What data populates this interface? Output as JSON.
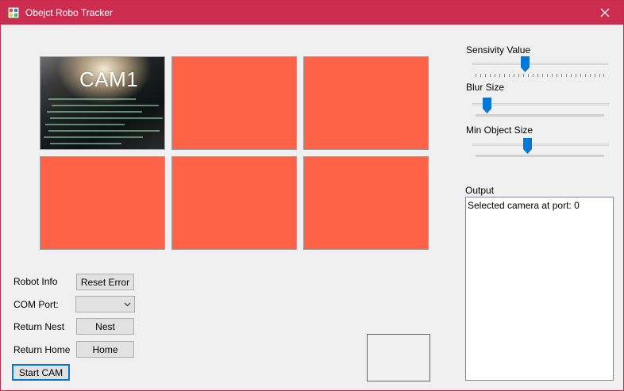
{
  "window": {
    "title": "Obejct Robo Tracker",
    "accent_color": "#cc2c50",
    "icons": {
      "app": "app-grid-icon",
      "close": "close-icon"
    }
  },
  "cameras": {
    "cam1_label": "CAM1",
    "tile_color": "#ff6347",
    "tiles": [
      "cam1",
      "cam2",
      "cam3",
      "cam4",
      "cam5",
      "cam6"
    ]
  },
  "controls": {
    "robot_info_label": "Robot Info",
    "reset_error_label": "Reset Error",
    "com_port_label": "COM Port:",
    "com_port_value": "",
    "return_nest_label": "Return Nest",
    "nest_button_label": "Nest",
    "return_home_label": "Return Home",
    "home_button_label": "Home",
    "start_cam_label": "Start CAM"
  },
  "settings": {
    "sensitivity_label": "Sensivity Value",
    "sensitivity_level": 0.39,
    "blur_label": "Blur Size",
    "blur_level": 0.1,
    "min_object_label": "Min Object Size",
    "min_object_level": 0.41
  },
  "output": {
    "label": "Output",
    "lines": [
      "Selected camera at port: 0"
    ]
  }
}
